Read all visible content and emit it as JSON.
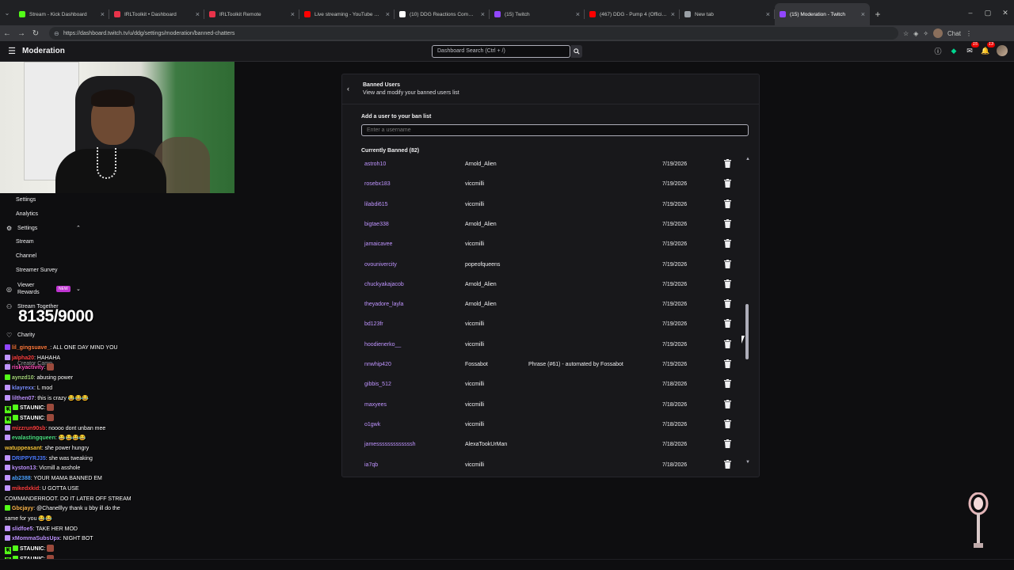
{
  "browser": {
    "tabs": [
      {
        "title": "Stream - Kick Dashboard",
        "color": "#53fc18"
      },
      {
        "title": "IRLToolkit • Dashboard",
        "color": "#e8334a"
      },
      {
        "title": "IRLToolkit Remote",
        "color": "#e8334a"
      },
      {
        "title": "Live streaming - YouTube Studio",
        "color": "#ff0000"
      },
      {
        "title": "(10) DDG Reactions Community / X",
        "color": "#ffffff"
      },
      {
        "title": "(15) Twitch",
        "color": "#9146ff"
      },
      {
        "title": "(467) DDG - Pump 4 (Official Mus...",
        "color": "#ff0000"
      },
      {
        "title": "New tab",
        "color": "#9aa0a6"
      },
      {
        "title": "(15) Moderation - Twitch",
        "color": "#9146ff"
      }
    ],
    "url": "https://dashboard.twitch.tv/u/ddg/settings/moderation/banned-chatters",
    "chat_ext_label": "Chat"
  },
  "header": {
    "title": "Moderation",
    "search_placeholder": "Dashboard Search (Ctrl + /)",
    "notif_count": "15",
    "inbox_count": "13"
  },
  "leftnav": {
    "settings_top": "Settings",
    "analytics": "Analytics",
    "settings": "Settings",
    "stream": "Stream",
    "channel": "Channel",
    "streamer_survey": "Streamer Survey",
    "viewer_rewards_1": "Viewer",
    "viewer_rewards_2": "Rewards",
    "new_badge": "NEW",
    "stream_together": "Stream Together",
    "charity": "Charity",
    "creator_camp": "Creator Camp"
  },
  "counter": "8135/9000",
  "chat": [
    {
      "user": "lil_gingsuave_",
      "color": "#ff7a3d",
      "msg": "ALL ONE DAY MIND YOU",
      "badge": "#9146ff"
    },
    {
      "user": "jalpha20",
      "color": "#ff4040",
      "msg": "HAHAHA",
      "badge": "#bf94ff"
    },
    {
      "user": "riskyactivity",
      "color": "#ff4fb8",
      "msg": "",
      "badge": "#bf94ff",
      "emote": true
    },
    {
      "user": "aynzd10",
      "color": "#a7d57b",
      "msg": "abusing power",
      "badge": "#53fc18"
    },
    {
      "user": "klayrexx",
      "color": "#7b8fff",
      "msg": "L mod",
      "badge": "#bf94ff"
    },
    {
      "user": "lilthen07",
      "color": "#bf94ff",
      "msg": "this is crazy 😂😂😂",
      "badge": "#bf94ff"
    },
    {
      "user": "STAUNIC",
      "color": "#ffffff",
      "msg": "",
      "badge": "#53fc18",
      "kick": true,
      "emote": true
    },
    {
      "user": "STAUNIC",
      "color": "#ffffff",
      "msg": "",
      "badge": "#53fc18",
      "kick": true,
      "emote": true
    },
    {
      "user": "mizzrun90sb",
      "color": "#ff4040",
      "msg": "noooo dont unban mee",
      "badge": "#bf94ff"
    },
    {
      "user": "evalastingqueen",
      "color": "#4ade80",
      "msg": "😂😂😂😂",
      "badge": "#bf94ff"
    },
    {
      "user": "watuppeasant",
      "color": "#f3c23a",
      "msg": "she power hungry",
      "badge": ""
    },
    {
      "user": "DRIPPYRJ35",
      "color": "#4d7cff",
      "msg": "she was tweaking",
      "badge": "#bf94ff"
    },
    {
      "user": "kyston13",
      "color": "#bf94ff",
      "msg": "Vicmill a asshole",
      "badge": "#bf94ff"
    },
    {
      "user": "ab2388",
      "color": "#4da3ff",
      "msg": "YOUR MAMA BANNED EM",
      "badge": "#bf94ff"
    },
    {
      "user": "mikedxkid",
      "color": "#ff4040",
      "msg": "U GOTTA USE",
      "badge": "#bf94ff"
    },
    {
      "user": "",
      "color": "#ffffff",
      "msg": "COMMANDERROOT. DO IT LATER OFF STREAM",
      "badge": ""
    },
    {
      "user": "Gbcjayy",
      "color": "#ffb84d",
      "msg": "@Chanelllyy thank u bby ill do the",
      "badge": "#53fc18"
    },
    {
      "user": "",
      "color": "#ffffff",
      "msg": "same for you 😂😂",
      "badge": ""
    },
    {
      "user": "slidfoe5",
      "color": "#bf94ff",
      "msg": "TAKE HER MOD",
      "badge": "#bf94ff"
    },
    {
      "user": "xMommaSubsUpx",
      "color": "#bf94ff",
      "msg": "NIGHT BOT",
      "badge": "#bf94ff"
    },
    {
      "user": "STAUNIC",
      "color": "#ffffff",
      "msg": "",
      "badge": "#53fc18",
      "kick": true,
      "emote": true
    },
    {
      "user": "STAUNIC",
      "color": "#ffffff",
      "msg": "",
      "badge": "#53fc18",
      "kick": true,
      "emote": true
    }
  ],
  "panel": {
    "title": "Banned Users",
    "subtitle": "View and modify your banned users list",
    "add_label": "Add a user to your ban list",
    "add_placeholder": "Enter a username",
    "current_label": "Currently Banned (82)",
    "banned": [
      {
        "user": "astroh10",
        "mod": "Arnold_Alien",
        "reason": "",
        "date": "7/19/2026"
      },
      {
        "user": "rosebx183",
        "mod": "viccmilli",
        "reason": "",
        "date": "7/19/2026"
      },
      {
        "user": "lilabdi615",
        "mod": "viccmilli",
        "reason": "",
        "date": "7/19/2026"
      },
      {
        "user": "bigtae338",
        "mod": "Arnold_Alien",
        "reason": "",
        "date": "7/19/2026"
      },
      {
        "user": "jamaicavee",
        "mod": "viccmilli",
        "reason": "",
        "date": "7/19/2026"
      },
      {
        "user": "ovounivercity",
        "mod": "popeofqueens",
        "reason": "",
        "date": "7/19/2026"
      },
      {
        "user": "chuckyakajacob",
        "mod": "Arnold_Alien",
        "reason": "",
        "date": "7/19/2026"
      },
      {
        "user": "theyadore_layla",
        "mod": "Arnold_Alien",
        "reason": "",
        "date": "7/19/2026"
      },
      {
        "user": "bd123fr",
        "mod": "viccmilli",
        "reason": "",
        "date": "7/19/2026"
      },
      {
        "user": "hoodienerko__",
        "mod": "viccmilli",
        "reason": "",
        "date": "7/19/2026"
      },
      {
        "user": "nnwhip420",
        "mod": "Fossabot",
        "reason": "Phrase (#61) - automated by Fossabot",
        "date": "7/19/2026"
      },
      {
        "user": "gibbis_512",
        "mod": "viccmilli",
        "reason": "",
        "date": "7/18/2026"
      },
      {
        "user": "maxyees",
        "mod": "viccmilli",
        "reason": "",
        "date": "7/18/2026"
      },
      {
        "user": "o1gwk",
        "mod": "viccmilli",
        "reason": "",
        "date": "7/18/2026"
      },
      {
        "user": "jamesssssssssssssh",
        "mod": "AlexaTookUrMan",
        "reason": "",
        "date": "7/18/2026"
      },
      {
        "user": "ia7qb",
        "mod": "viccmilli",
        "reason": "",
        "date": "7/18/2026"
      }
    ]
  }
}
